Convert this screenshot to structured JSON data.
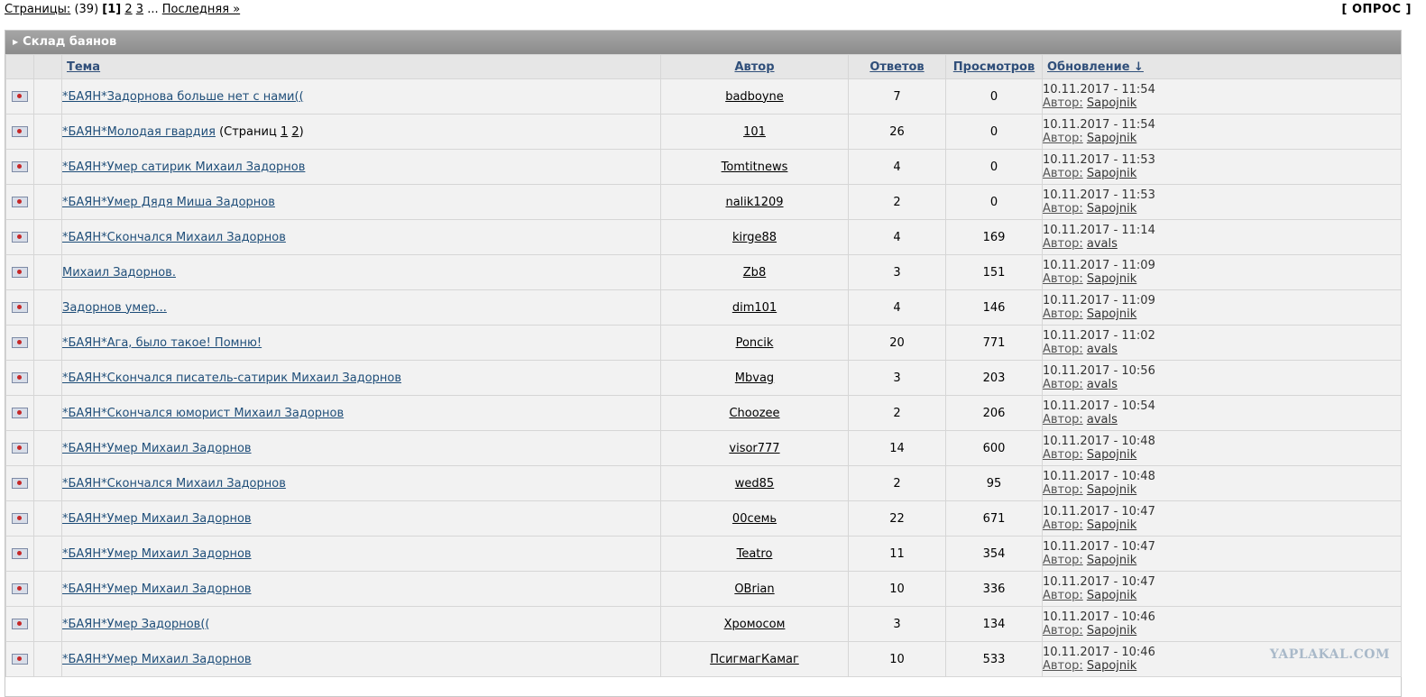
{
  "pager": {
    "label": "Страницы:",
    "count": "(39)",
    "current": "[1]",
    "p2": "2",
    "p3": "3",
    "ellipsis": "...",
    "last": "Последняя »"
  },
  "poll": "[ ОПРОС ]",
  "category": "Склад баянов",
  "headers": {
    "topic": "Тема",
    "author": "Автор",
    "replies": "Ответов",
    "views": "Просмотров",
    "updated": "Обновление ↓"
  },
  "update_author_label": "Автор:",
  "topics": [
    {
      "title": "*БАЯН*Задорнова больше нет с нами((",
      "author": "badboyne",
      "replies": "7",
      "views": "0",
      "date": "10.11.2017 - 11:54",
      "last_author": "Sapojnik"
    },
    {
      "title": "*БАЯН*Молодая гвардия",
      "pages_prefix": "(Страниц ",
      "p1": "1",
      "p2": "2",
      "pages_suffix": ")",
      "author": "101",
      "replies": "26",
      "views": "0",
      "date": "10.11.2017 - 11:54",
      "last_author": "Sapojnik"
    },
    {
      "title": "*БАЯН*Умер сатирик Михаил Задорнов",
      "author": "Tomtitnews",
      "replies": "4",
      "views": "0",
      "date": "10.11.2017 - 11:53",
      "last_author": "Sapojnik"
    },
    {
      "title": "*БАЯН*Умер Дядя Миша Задорнов",
      "author": "nalik1209",
      "replies": "2",
      "views": "0",
      "date": "10.11.2017 - 11:53",
      "last_author": "Sapojnik"
    },
    {
      "title": "*БАЯН*Скончался Михаил Задорнов",
      "author": "kirge88",
      "replies": "4",
      "views": "169",
      "date": "10.11.2017 - 11:14",
      "last_author": "avals"
    },
    {
      "title": "Михаил Задорнов.",
      "author": "Zb8",
      "replies": "3",
      "views": "151",
      "date": "10.11.2017 - 11:09",
      "last_author": "Sapojnik"
    },
    {
      "title": "Задорнов умер...",
      "author": "dim101",
      "replies": "4",
      "views": "146",
      "date": "10.11.2017 - 11:09",
      "last_author": "Sapojnik"
    },
    {
      "title": "*БАЯН*Ага, было такое! Помню!",
      "author": "Poncik",
      "replies": "20",
      "views": "771",
      "date": "10.11.2017 - 11:02",
      "last_author": "avals"
    },
    {
      "title": "*БАЯН*Скончался писатель-сатирик Михаил Задорнов",
      "author": "Mbvag",
      "replies": "3",
      "views": "203",
      "date": "10.11.2017 - 10:56",
      "last_author": "avals"
    },
    {
      "title": "*БАЯН*Скончался юморист Михаил Задорнов",
      "author": "Choozee",
      "replies": "2",
      "views": "206",
      "date": "10.11.2017 - 10:54",
      "last_author": "avals"
    },
    {
      "title": "*БАЯН*Умер Михаил Задорнов",
      "author": "visor777",
      "replies": "14",
      "views": "600",
      "date": "10.11.2017 - 10:48",
      "last_author": "Sapojnik"
    },
    {
      "title": "*БАЯН*Скончался Михаил Задорнов",
      "author": "wed85",
      "replies": "2",
      "views": "95",
      "date": "10.11.2017 - 10:48",
      "last_author": "Sapojnik"
    },
    {
      "title": "*БАЯН*Умер Михаил Задорнов",
      "author": "00семь",
      "replies": "22",
      "views": "671",
      "date": "10.11.2017 - 10:47",
      "last_author": "Sapojnik"
    },
    {
      "title": "*БАЯН*Умер Михаил Задорнов",
      "author": "Teatro",
      "replies": "11",
      "views": "354",
      "date": "10.11.2017 - 10:47",
      "last_author": "Sapojnik"
    },
    {
      "title": "*БАЯН*Умер Михаил Задорнов",
      "author": "OBrian",
      "replies": "10",
      "views": "336",
      "date": "10.11.2017 - 10:47",
      "last_author": "Sapojnik"
    },
    {
      "title": "*БАЯН*Умер Задорнов((",
      "author": "Хромосом",
      "replies": "3",
      "views": "134",
      "date": "10.11.2017 - 10:46",
      "last_author": "Sapojnik"
    },
    {
      "title": "*БАЯН*Умер Михаил Задорнов",
      "author": "ПсигмагКамаг",
      "replies": "10",
      "views": "533",
      "date": "10.11.2017 - 10:46",
      "last_author": "Sapojnik"
    }
  ],
  "watermark": "YAPLAKAL.COM",
  "icons": {
    "topic": "closed-topic-icon",
    "category": "arrow-right-icon"
  }
}
